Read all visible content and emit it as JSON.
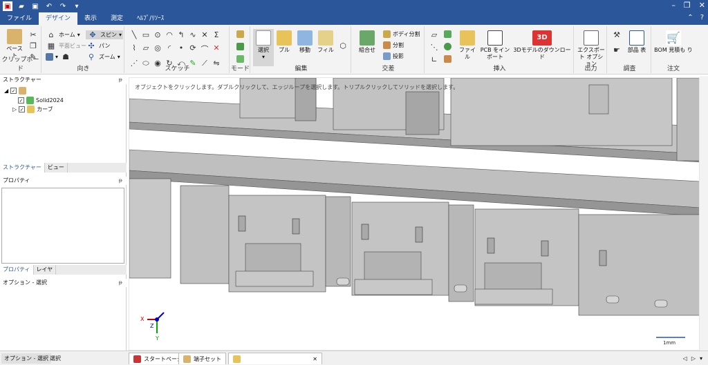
{
  "title_bar": {
    "window_controls": [
      "–",
      "❐",
      "✕"
    ]
  },
  "menu": {
    "items": [
      "ファイル",
      "デザイン",
      "表示",
      "測定",
      "ﾍﾙﾌﾟ/ﾘｿｰｽ"
    ],
    "active": "デザイン"
  },
  "ribbon": {
    "clipboard": {
      "label": "クリップボード",
      "paste": "ペースト"
    },
    "orient": {
      "label": "向き",
      "home": "ホーム",
      "plane_view": "平面ビュー",
      "spin": "スピン",
      "pan": "パン",
      "zoom": "ズーム"
    },
    "sketch": {
      "label": "スケッチ"
    },
    "mode": {
      "label": "モード"
    },
    "edit": {
      "label": "編集",
      "select": "選択",
      "pull": "プル",
      "move": "移動",
      "fill": "フィル"
    },
    "intersect": {
      "label": "交差",
      "combine": "組合せ",
      "split_body": "ボディ分割",
      "split": "分割",
      "project": "投影"
    },
    "insert": {
      "label": "挿入",
      "file": "ファイル",
      "pcb": "PCB をイン ポート",
      "download": "3Dモデルのダウンロード"
    },
    "output": {
      "label": "出力",
      "export": "エクスポート オプション"
    },
    "investigate": {
      "label": "調査",
      "bom_tbl": "部品 表"
    },
    "order": {
      "label": "注文",
      "bom": "BOM 見積も り"
    }
  },
  "structure_panel": {
    "title": "ストラクチャー",
    "tree": [
      {
        "label": "Solid2024"
      },
      {
        "label": "カーブ"
      }
    ],
    "tabs": [
      "ストラクチャー",
      "ビュー"
    ]
  },
  "properties_panel": {
    "title": "プロパティ",
    "tabs": [
      "プロパティ",
      "レイヤ"
    ]
  },
  "options_panel": {
    "title": "オプション - 選択"
  },
  "viewport": {
    "hint": "オブジェクトをクリックします。ダブルクリックして、エッジループを選択します。トリプルクリックしてソリッドを選択します。",
    "scale": "1mm",
    "axes": {
      "x": "X",
      "y": "Y",
      "z": "Z"
    }
  },
  "status": {
    "left_tabs": [
      "オプション - 選択",
      "選択"
    ],
    "docs": [
      "スタートページ",
      "端子セット",
      ""
    ]
  },
  "colors": {
    "accent": "#2b579a",
    "model": "#b9b9b9",
    "model_dark": "#8f8f8f"
  }
}
